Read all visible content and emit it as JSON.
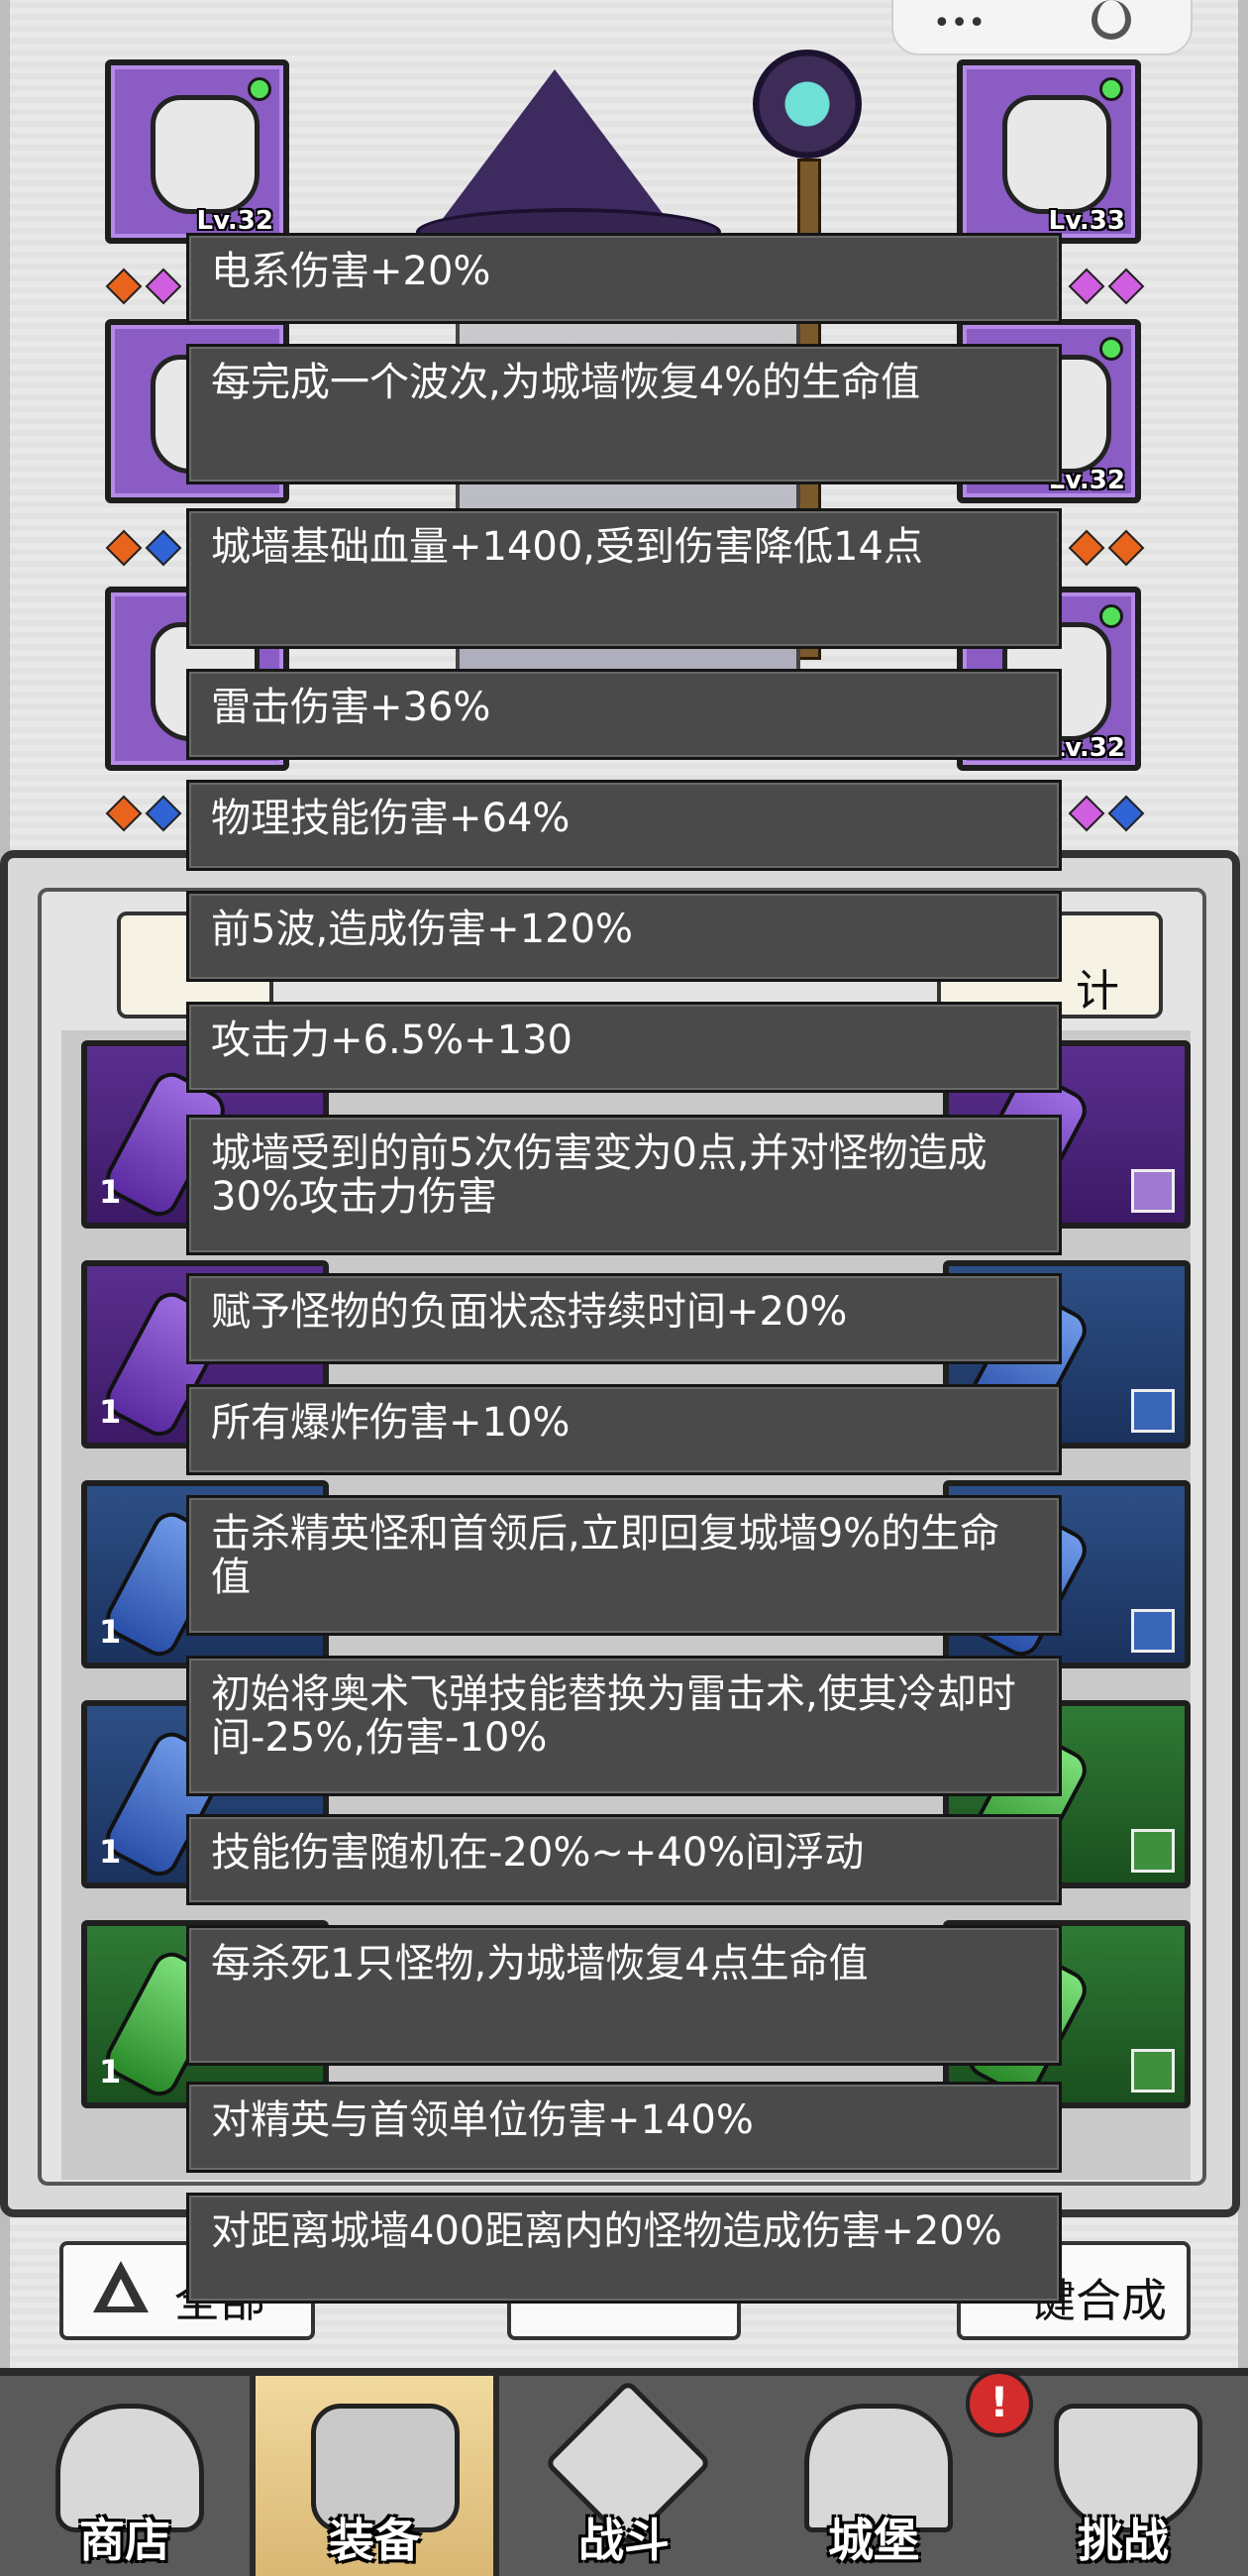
{
  "equipment": {
    "left": [
      {
        "level": "Lv.32"
      },
      {
        "level": ""
      },
      {
        "level": ""
      }
    ],
    "right": [
      {
        "level": "Lv.33"
      },
      {
        "level": "Lv.32"
      },
      {
        "level": "Lv.32"
      }
    ]
  },
  "panel": {
    "stat_label": "计"
  },
  "inventory_counts": [
    "1",
    "1",
    "1",
    "1",
    "1"
  ],
  "actions": {
    "left_label": "全部",
    "right_label": "键合成"
  },
  "tooltip": {
    "effects": [
      "电系伤害+20%",
      "每完成一个波次,为城墙恢复4%的生命值",
      "城墙基础血量+1400,受到伤害降低14点",
      "雷击伤害+36%",
      "物理技能伤害+64%",
      "前5波,造成伤害+120%",
      "攻击力+6.5%+130",
      "城墙受到的前5次伤害变为0点,并对怪物造成30%攻击力伤害",
      "赋予怪物的负面状态持续时间+20%",
      "所有爆炸伤害+10%",
      "击杀精英怪和首领后,立即回复城墙9%的生命值",
      "初始将奥术飞弹技能替换为雷击术,使其冷却时间-25%,伤害-10%",
      "技能伤害随机在-20%~+40%间浮动",
      "每杀死1只怪物,为城墙恢复4点生命值",
      "对精英与首领单位伤害+140%",
      "对距离城墙400距离内的怪物造成伤害+20%"
    ]
  },
  "nav": {
    "items": [
      {
        "label": "商店",
        "icon": "shop-icon"
      },
      {
        "label": "装备",
        "icon": "backpack-icon"
      },
      {
        "label": "战斗",
        "icon": "crossed-swords-icon"
      },
      {
        "label": "城堡",
        "icon": "castle-icon"
      },
      {
        "label": "挑战",
        "icon": "shield-icon"
      }
    ],
    "notification": "!"
  },
  "colors": {
    "tooltip_bg": "#4a4a4a",
    "slot_purple": "#8a5cc4",
    "nav_bg": "#5a5a5a",
    "active_tab": "#e6c788",
    "badge_red": "#d42c2c"
  }
}
